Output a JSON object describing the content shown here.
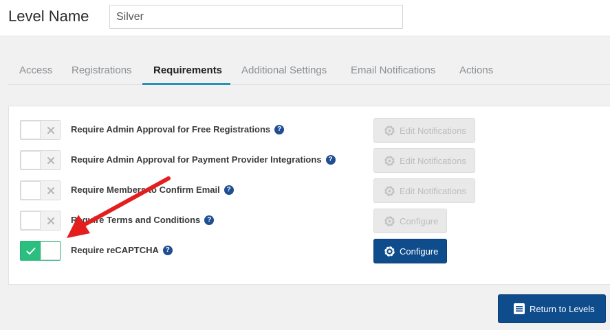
{
  "header": {
    "level_label": "Level Name",
    "level_value": "Silver"
  },
  "tabs": [
    {
      "label": "Access",
      "active": false
    },
    {
      "label": "Registrations",
      "active": false
    },
    {
      "label": "Requirements",
      "active": true
    },
    {
      "label": "Additional Settings",
      "active": false
    },
    {
      "label": "Email Notifications",
      "active": false
    },
    {
      "label": "Actions",
      "active": false
    }
  ],
  "requirements": [
    {
      "label": "Require Admin Approval for Free Registrations",
      "enabled": false,
      "button": "Edit Notifications",
      "button_enabled": false
    },
    {
      "label": "Require Admin Approval for Payment Provider Integrations",
      "enabled": false,
      "button": "Edit Notifications",
      "button_enabled": false
    },
    {
      "label": "Require Members to Confirm Email",
      "enabled": false,
      "button": "Edit Notifications",
      "button_enabled": false
    },
    {
      "label": "Require Terms and Conditions",
      "enabled": false,
      "button": "Configure",
      "button_enabled": false
    },
    {
      "label": "Require reCAPTCHA",
      "enabled": true,
      "button": "Configure",
      "button_enabled": true
    }
  ],
  "help_glyph": "?",
  "footer": {
    "return_label": "Return to Levels"
  },
  "icons": {
    "toggle_off": "close-icon",
    "toggle_on": "check-icon",
    "help": "question-circle-icon",
    "button": "gear-icon",
    "return": "list-icon",
    "annotation": "red-arrow"
  },
  "colors": {
    "accent": "#2c8fb7",
    "primary_button": "#0f4c8c",
    "toggle_on": "#2abf7e",
    "help_icon": "#1f4e92",
    "arrow": "#e41e1e"
  }
}
